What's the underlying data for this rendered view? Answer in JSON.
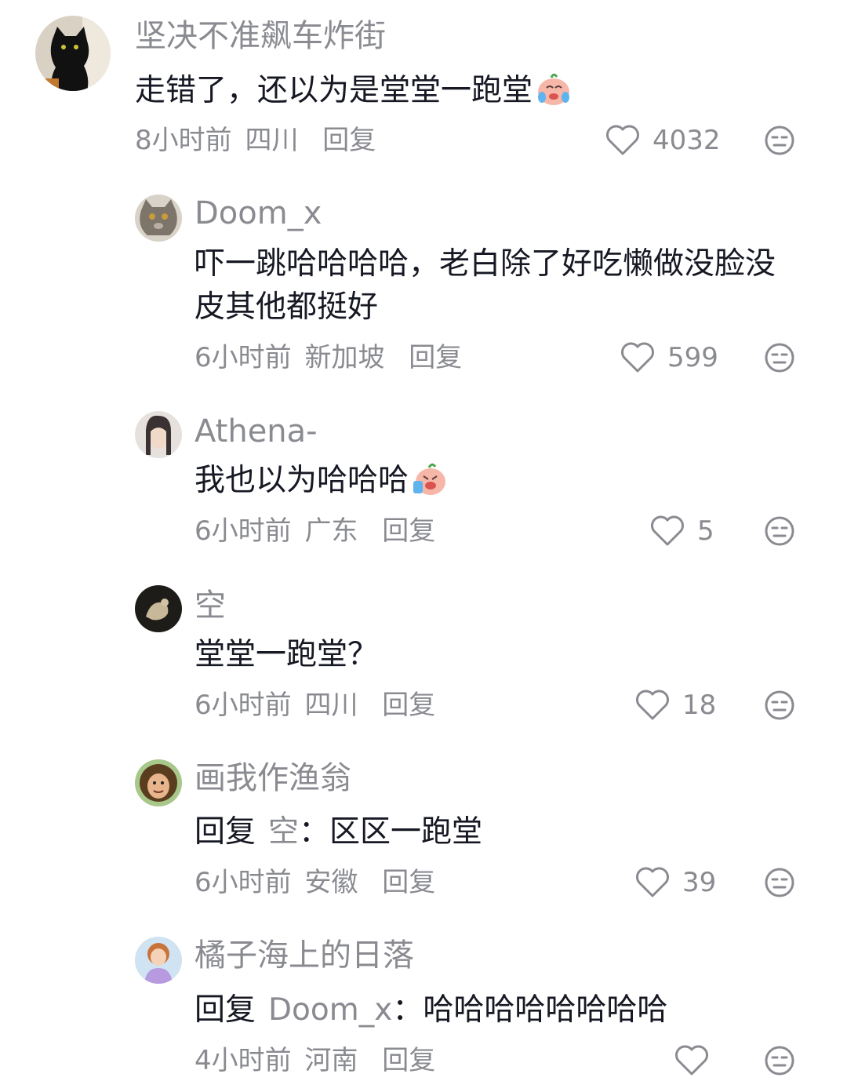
{
  "comments": [
    {
      "username": "坚决不准飙车炸街",
      "text": "走错了，还以为是堂堂一跑堂",
      "emoji": "crying-face-emoji",
      "time": "8小时前",
      "location": "四川",
      "reply_label": "回复",
      "likes": "4032"
    },
    {
      "username": "Doom_x",
      "text": "吓一跳哈哈哈哈，老白除了好吃懒做没脸没皮其他都挺好",
      "time": "6小时前",
      "location": "新加坡",
      "reply_label": "回复",
      "likes": "599"
    },
    {
      "username": "Athena-",
      "text": "我也以为哈哈哈",
      "emoji": "laughing-crying-emoji",
      "time": "6小时前",
      "location": "广东",
      "reply_label": "回复",
      "likes": "5"
    },
    {
      "username": "空",
      "text": "堂堂一跑堂？",
      "time": "6小时前",
      "location": "四川",
      "reply_label": "回复",
      "likes": "18"
    },
    {
      "username": "画我作渔翁",
      "reply_prefix": "回复",
      "reply_target": "空",
      "colon": "：",
      "text": "区区一跑堂",
      "time": "6小时前",
      "location": "安徽",
      "reply_label": "回复",
      "likes": "39"
    },
    {
      "username": "橘子海上的日落",
      "reply_prefix": "回复",
      "reply_target": "Doom_x",
      "colon": "：",
      "text": "哈哈哈哈哈哈哈哈",
      "time": "4小时前",
      "location": "河南",
      "reply_label": "回复",
      "likes": ""
    }
  ],
  "icons": {
    "like": "heart-outline-icon",
    "dislike": "meh-face-icon"
  },
  "colors": {
    "primary_text": "#161823",
    "secondary_text": "#8a8b91",
    "icon": "#8a8b91"
  }
}
